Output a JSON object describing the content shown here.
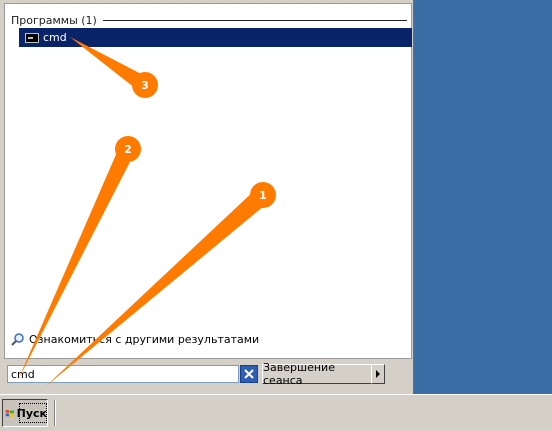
{
  "start_menu": {
    "group_header": "Программы (1)",
    "results": [
      {
        "label": "cmd",
        "icon": "command-prompt-icon"
      }
    ],
    "more_results_label": "Ознакомиться с другими результатами",
    "search": {
      "value": "cmd"
    },
    "logoff_label": "Завершение сеанса"
  },
  "taskbar": {
    "start_label": "Пуск"
  },
  "callouts": [
    "1",
    "2",
    "3"
  ],
  "colors": {
    "desktop": "#3a6ea5",
    "selection": "#0a246a",
    "callout": "#ff7b00"
  }
}
